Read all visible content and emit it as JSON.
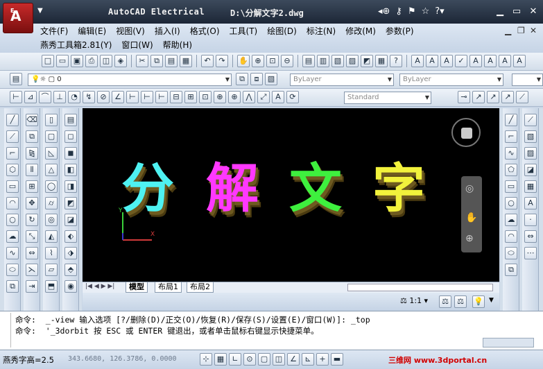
{
  "titlebar": {
    "app_title": "AutoCAD Electrical",
    "file_path": "D:\\分解文字2.dwg"
  },
  "menu": {
    "row1": [
      "文件(F)",
      "编辑(E)",
      "视图(V)",
      "插入(I)",
      "格式(O)",
      "工具(T)",
      "绘图(D)",
      "标注(N)",
      "修改(M)",
      "参数(P)"
    ],
    "row2": [
      "燕秀工具箱2.81(Y)",
      "窗口(W)",
      "帮助(H)"
    ]
  },
  "properties": {
    "layer_value": "0",
    "color_value": "ByLayer",
    "linetype_value": "ByLayer",
    "text_style": "Standard",
    "extra_combo": "Stan"
  },
  "drawing": {
    "chars": [
      "分",
      "解",
      "文",
      "字"
    ],
    "colors": [
      "#4ef2f2",
      "#ff38ff",
      "#3ef03e",
      "#f2f23c"
    ]
  },
  "layout_tabs": [
    "模型",
    "布局1",
    "布局2"
  ],
  "viewport_status": {
    "scale": "1:1"
  },
  "command": {
    "line1": "命令:  _-view 输入选项 [?/删除(D)/正交(O)/恢复(R)/保存(S)/设置(E)/窗口(W)]: _top",
    "line2": "命令:  '_3dorbit 按 ESC 或 ENTER 键退出，或者单击鼠标右键显示快捷菜单。"
  },
  "status": {
    "label": "燕秀字高=2.5",
    "coords": "343.6680, 126.3786, 0.0000",
    "watermark": "三维网 www.3dportal.cn"
  }
}
